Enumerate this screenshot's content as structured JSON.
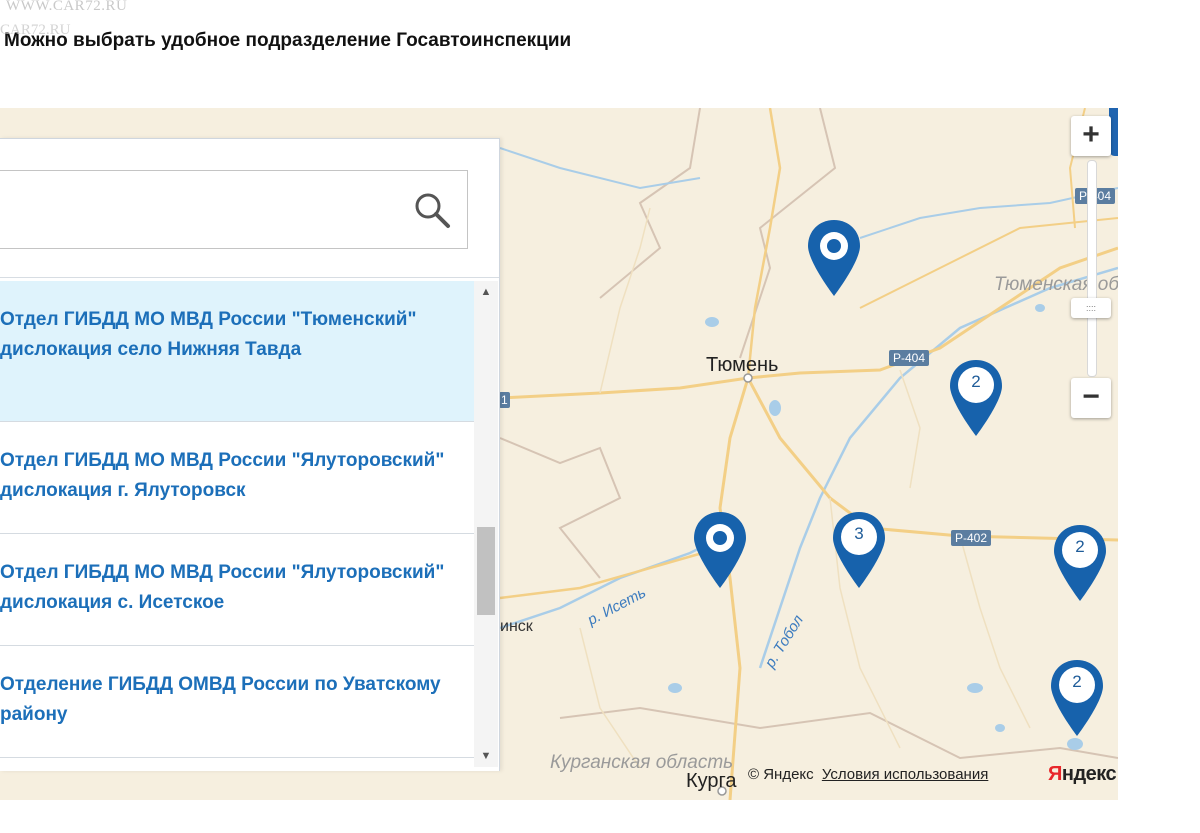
{
  "watermark": {
    "site": "WWW.CAR72.RU",
    "overlay": "CAR72.RU"
  },
  "page": {
    "heading": "Можно выбрать удобное подразделение Госавтоинспекции"
  },
  "search": {
    "value": "",
    "placeholder": "",
    "icon": "search-icon"
  },
  "list": {
    "selected_index": 0,
    "items": [
      {
        "label": "Отдел ГИБДД МО МВД России \"Тюменский\" дислокация село Нижняя Тавда"
      },
      {
        "label": "Отдел ГИБДД МО МВД России \"Ялуторовский\" дислокация г. Ялуторовск"
      },
      {
        "label": "Отдел ГИБДД МО МВД России \"Ялуторовский\" дислокация с. Исетское"
      },
      {
        "label": "Отделение ГИБДД ОМВД России по Уватскому району"
      }
    ],
    "scroll_position": 0.52
  },
  "map": {
    "city": "Тюмень",
    "city2": "Курга",
    "partial_city": "инск",
    "region_tyumen": "Тюменская об",
    "region_kurgan": "Курганская область",
    "river_iset": "р. Исеть",
    "river_tobol": "р. Тобол",
    "roads": [
      "Р-404",
      "Р-404",
      "Р-402"
    ],
    "left_badge": "1",
    "pins": [
      {
        "kind": "single",
        "count": ""
      },
      {
        "kind": "cluster",
        "count": "2"
      },
      {
        "kind": "single",
        "count": ""
      },
      {
        "kind": "cluster",
        "count": "3"
      },
      {
        "kind": "cluster",
        "count": "2"
      },
      {
        "kind": "cluster",
        "count": "2"
      }
    ],
    "pin_color": "#1762ac",
    "zoom_in": "+",
    "zoom_out": "−",
    "zoom_thumb": "::::",
    "copyright": "© Яндекс",
    "terms": "Условия использования",
    "logo_first": "Я",
    "logo_rest": "ндекс"
  }
}
